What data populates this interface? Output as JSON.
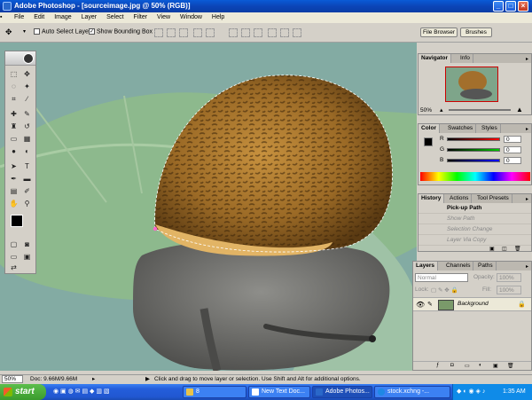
{
  "window": {
    "title": "Adobe Photoshop - [sourceimage.jpg @ 50% (RGB)]",
    "min": "_",
    "max": "□",
    "close": "×"
  },
  "menu": [
    "File",
    "Edit",
    "Image",
    "Layer",
    "Select",
    "Filter",
    "View",
    "Window",
    "Help"
  ],
  "options": {
    "auto_select_layer": "Auto Select Layer",
    "show_bounding_box": "Show Bounding Box",
    "file_browser": "File Browser",
    "brushes": "Brushes"
  },
  "navigator": {
    "tabs": [
      "Navigator",
      "Info"
    ],
    "zoom": "50%"
  },
  "color": {
    "tabs": [
      "Color",
      "Swatches",
      "Styles"
    ],
    "channels": [
      "R",
      "G",
      "B"
    ],
    "values": [
      "0",
      "0",
      "0"
    ]
  },
  "history": {
    "tabs": [
      "History",
      "Actions",
      "Tool Presets"
    ],
    "items": [
      "Pick-up Path",
      "Show Path",
      "Selection Change",
      "Layer Via Copy"
    ]
  },
  "layers": {
    "tabs": [
      "Layers",
      "Channels",
      "Paths"
    ],
    "blend_mode": "Normal",
    "opacity_label": "Opacity:",
    "opacity_value": "100%",
    "lock_label": "Lock:",
    "fill_label": "Fill:",
    "fill_value": "100%",
    "layer_name": "Background"
  },
  "status": {
    "zoom": "50%",
    "doc": "Doc: 9.66M/9.66M",
    "hint": "Click and drag to move layer or selection. Use Shift and Alt for additional options."
  },
  "taskbar": {
    "start": "start",
    "items": [
      "8",
      "New Text Doc...",
      "Adobe Photos...",
      "stock.xchng -..."
    ],
    "clock": "1:35 AM"
  },
  "colors": {
    "xp_blue": "#245edb",
    "start_green": "#3a9b2d",
    "panel_gray": "#d4d0c8"
  }
}
